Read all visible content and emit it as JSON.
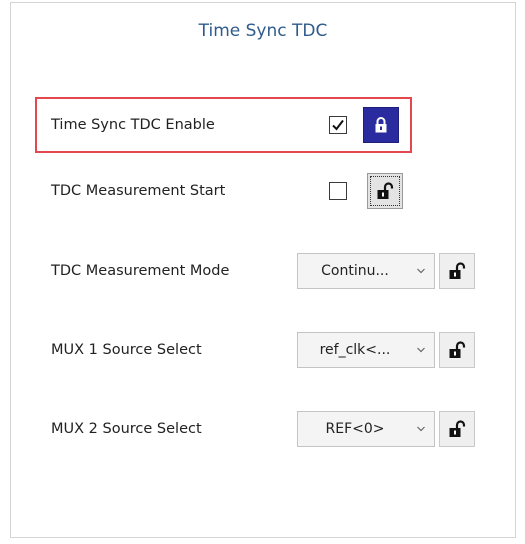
{
  "panel": {
    "title": "Time Sync TDC"
  },
  "rows": [
    {
      "label": "Time Sync TDC Enable",
      "control": "checkbox",
      "checked": true,
      "lock_state": "locked",
      "lock_icon": "lock-closed-icon",
      "highlighted": true
    },
    {
      "label": "TDC Measurement Start",
      "control": "checkbox",
      "checked": false,
      "lock_state": "unlocked",
      "lock_icon": "lock-open-icon",
      "focused": true
    },
    {
      "label": "TDC Measurement Mode",
      "control": "dropdown",
      "value": "Continu...",
      "lock_state": "unlocked",
      "lock_icon": "lock-open-icon"
    },
    {
      "label": "MUX 1 Source Select",
      "control": "dropdown",
      "value": "ref_clk<...",
      "lock_state": "unlocked",
      "lock_icon": "lock-open-icon"
    },
    {
      "label": "MUX 2 Source Select",
      "control": "dropdown",
      "value": "REF<0>",
      "lock_state": "unlocked",
      "lock_icon": "lock-open-icon"
    }
  ],
  "colors": {
    "title": "#2f5b8c",
    "highlight_border": "#e3484e",
    "locked_button": "#2a2b9f",
    "unlocked_button": "#efefef"
  }
}
